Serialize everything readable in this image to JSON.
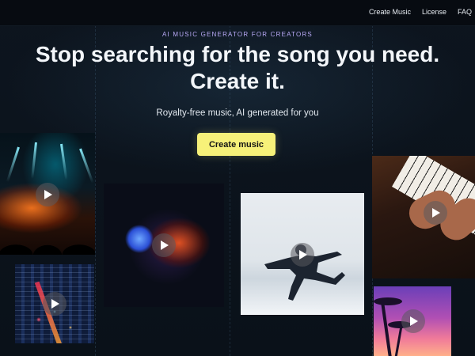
{
  "nav": {
    "create_music": "Create Music",
    "license": "License",
    "faq": "FAQ"
  },
  "hero": {
    "eyebrow": "AI MUSIC GENERATOR FOR CREATORS",
    "headline_line1": "Stop searching for the song you need.",
    "headline_line2": "Create it.",
    "subtitle": "Royalty-free music, AI generated for you",
    "cta_label": "Create music"
  },
  "tiles": [
    {
      "name": "concert",
      "icon": "play-icon"
    },
    {
      "name": "city-night",
      "icon": "play-icon"
    },
    {
      "name": "mirror-ball",
      "icon": "play-icon"
    },
    {
      "name": "dancer",
      "icon": "play-icon"
    },
    {
      "name": "piano",
      "icon": "play-icon"
    },
    {
      "name": "palm-trees",
      "icon": "play-icon"
    }
  ],
  "colors": {
    "background": "#0b121b",
    "cta": "#f7f179",
    "eyebrow": "#b9a9f6"
  }
}
